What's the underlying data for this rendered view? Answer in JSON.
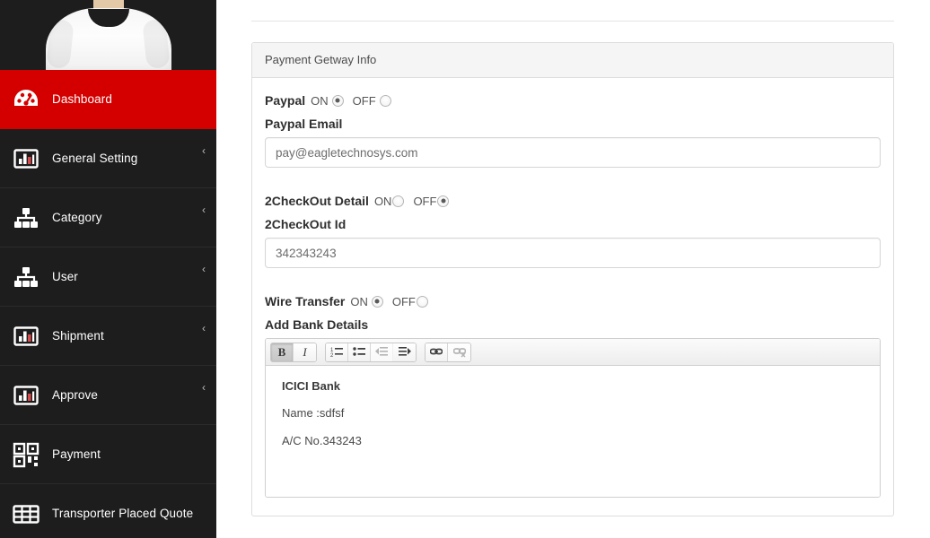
{
  "sidebar": {
    "brand": {
      "image_alt": "t-shirt-avatar"
    },
    "items": [
      {
        "label": "Dashboard",
        "icon": "dashboard-gauge-icon",
        "active": true,
        "chevron": ""
      },
      {
        "label": "General Setting",
        "icon": "bar-chart-icon",
        "active": false,
        "chevron": "‹"
      },
      {
        "label": "Category",
        "icon": "sitemap-icon",
        "active": false,
        "chevron": "‹"
      },
      {
        "label": "User",
        "icon": "sitemap-icon",
        "active": false,
        "chevron": "‹"
      },
      {
        "label": "Shipment",
        "icon": "bar-chart-icon",
        "active": false,
        "chevron": "‹"
      },
      {
        "label": "Approve",
        "icon": "bar-chart-icon",
        "active": false,
        "chevron": "‹"
      },
      {
        "label": "Payment",
        "icon": "qr-code-icon",
        "active": false,
        "chevron": ""
      },
      {
        "label": "Transporter Placed Quote",
        "icon": "table-grid-icon",
        "active": false,
        "chevron": ""
      }
    ]
  },
  "panel": {
    "title": "Payment Getway Info"
  },
  "form": {
    "paypal": {
      "label": "Paypal",
      "on_label": "ON",
      "off_label": "OFF",
      "selected": "ON",
      "email_label": "Paypal Email",
      "email_value": "pay@eagletechnosys.com",
      "email_placeholder": "Paypal Email"
    },
    "twocheckout": {
      "label": "2CheckOut Detail",
      "on_label": "ON",
      "off_label": "OFF",
      "selected": "OFF",
      "id_label": "2CheckOut Id",
      "id_value": "342343243",
      "id_placeholder": "2CheckOut Id"
    },
    "wire": {
      "label": "Wire Transfer",
      "on_label": "ON",
      "off_label": "OFF",
      "selected": "ON",
      "bank_label": "Add Bank Details"
    }
  },
  "editor": {
    "toolbar": [
      {
        "name": "bold-button",
        "icon": "bold-icon",
        "label": "B",
        "active": true,
        "disabled": false,
        "group": 1
      },
      {
        "name": "italic-button",
        "icon": "italic-icon",
        "label": "I",
        "active": false,
        "disabled": false,
        "group": 1
      },
      {
        "name": "ordered-list-button",
        "icon": "ordered-list-icon",
        "label": "",
        "active": false,
        "disabled": false,
        "group": 2
      },
      {
        "name": "unordered-list-button",
        "icon": "unordered-list-icon",
        "label": "",
        "active": false,
        "disabled": false,
        "group": 2
      },
      {
        "name": "outdent-button",
        "icon": "outdent-icon",
        "label": "",
        "active": false,
        "disabled": true,
        "group": 2
      },
      {
        "name": "indent-button",
        "icon": "indent-icon",
        "label": "",
        "active": false,
        "disabled": false,
        "group": 2
      },
      {
        "name": "link-button",
        "icon": "link-icon",
        "label": "",
        "active": false,
        "disabled": false,
        "group": 3
      },
      {
        "name": "unlink-button",
        "icon": "unlink-icon",
        "label": "",
        "active": false,
        "disabled": true,
        "group": 3
      }
    ],
    "content": [
      {
        "text": "ICICI Bank",
        "bold": true
      },
      {
        "text": "Name :sdfsf",
        "bold": false
      },
      {
        "text": "A/C No.343243",
        "bold": false
      }
    ]
  },
  "colors": {
    "sidebar_bg": "#1d1d1d",
    "active_red": "#d40000",
    "panel_border": "#dddddd",
    "panel_head_bg": "#f5f5f5"
  }
}
